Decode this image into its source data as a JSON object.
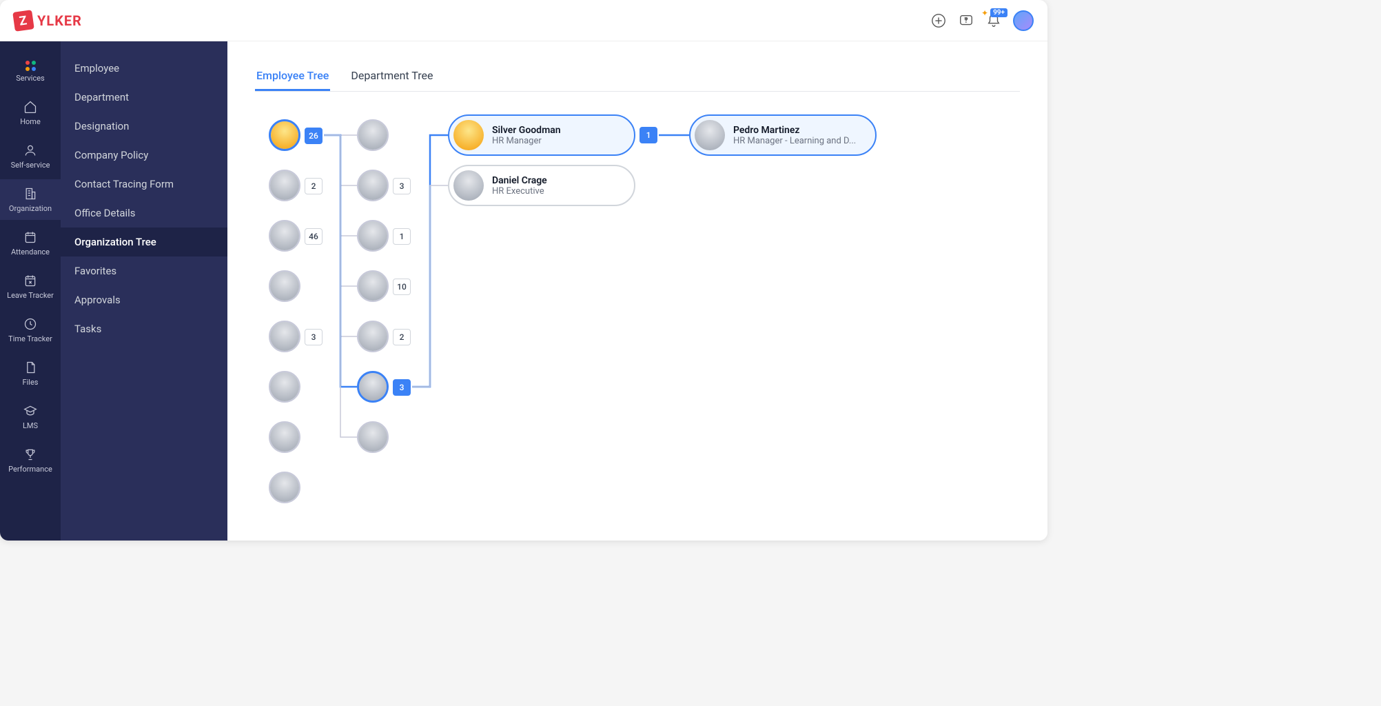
{
  "brand": {
    "letter": "Z",
    "name": "YLKER"
  },
  "header": {
    "notification_count": "99+"
  },
  "railNav": [
    {
      "label": "Services",
      "icon": "dots"
    },
    {
      "label": "Home",
      "icon": "home"
    },
    {
      "label": "Self-service",
      "icon": "person"
    },
    {
      "label": "Organization",
      "icon": "building",
      "active": true
    },
    {
      "label": "Attendance",
      "icon": "calendar"
    },
    {
      "label": "Leave Tracker",
      "icon": "calendar-x"
    },
    {
      "label": "Time Tracker",
      "icon": "clock"
    },
    {
      "label": "Files",
      "icon": "file"
    },
    {
      "label": "LMS",
      "icon": "grad"
    },
    {
      "label": "Performance",
      "icon": "trophy"
    }
  ],
  "sidebar": [
    {
      "label": "Employee"
    },
    {
      "label": "Department"
    },
    {
      "label": "Designation"
    },
    {
      "label": "Company Policy"
    },
    {
      "label": "Contact Tracing Form"
    },
    {
      "label": "Office Details"
    },
    {
      "label": "Organization Tree",
      "active": true
    },
    {
      "label": "Favorites"
    },
    {
      "label": "Approvals"
    },
    {
      "label": "Tasks"
    }
  ],
  "tabs": [
    {
      "label": "Employee Tree",
      "active": true
    },
    {
      "label": "Department Tree"
    }
  ],
  "tree": {
    "col1": [
      {
        "count": "26",
        "selected": true,
        "color": true
      },
      {
        "count": "2"
      },
      {
        "count": "46"
      },
      {
        "count": null
      },
      {
        "count": "3"
      },
      {
        "count": null
      },
      {
        "count": null
      },
      {
        "count": null
      }
    ],
    "col2": [
      {
        "count": null
      },
      {
        "count": "3"
      },
      {
        "count": "1"
      },
      {
        "count": "10"
      },
      {
        "count": "2"
      },
      {
        "count": "3",
        "selected": true
      },
      {
        "count": null
      }
    ],
    "col3": [
      {
        "name": "Silver Goodman",
        "role": "HR Manager",
        "selected": true,
        "color": true,
        "count": "1"
      },
      {
        "name": "Daniel Crage",
        "role": "HR Executive"
      }
    ],
    "col4": [
      {
        "name": "Pedro Martinez",
        "role": "HR Manager - Learning and D...",
        "selected": true
      }
    ]
  }
}
